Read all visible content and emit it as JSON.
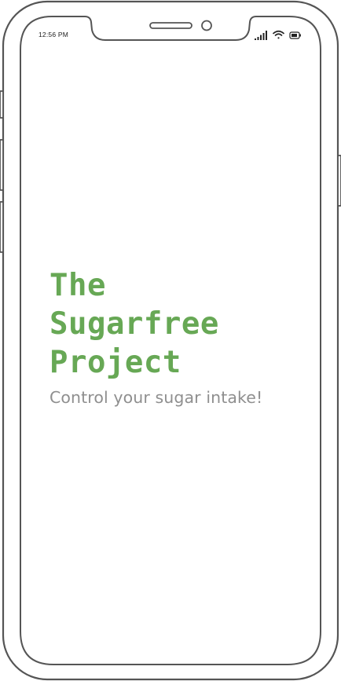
{
  "status_bar": {
    "time": "12:56 PM",
    "icons": [
      "cellular-signal-icon",
      "wifi-icon",
      "battery-icon"
    ]
  },
  "splash": {
    "title_lines": [
      "The",
      "Sugarfree",
      "Project"
    ],
    "subtitle": "Control your sugar intake!"
  },
  "colors": {
    "title": "#67a855",
    "subtitle": "#8f8f8f",
    "frame": "#555555",
    "background": "#ffffff"
  }
}
